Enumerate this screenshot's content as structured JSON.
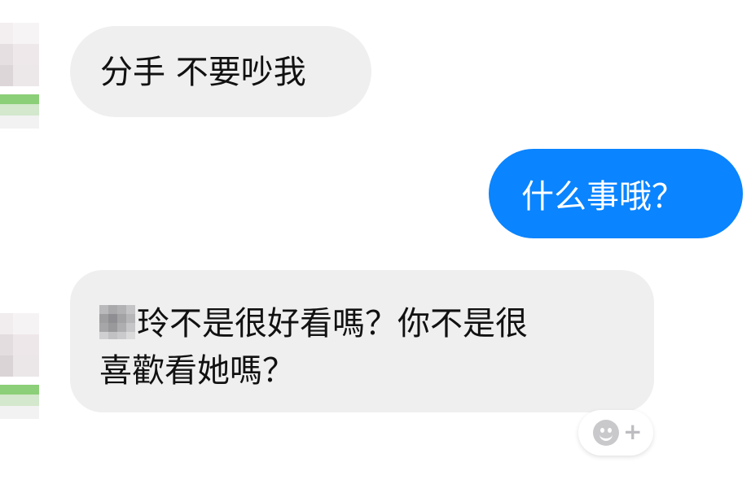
{
  "messages": [
    {
      "direction": "incoming",
      "text": "分手 不要吵我"
    },
    {
      "direction": "outgoing",
      "text": "什么事哦？"
    },
    {
      "direction": "incoming",
      "redacted_prefix": true,
      "line1": "玲不是很好看嗎？你不是很",
      "line2": "喜歡看她嗎？"
    }
  ],
  "reaction_button": {
    "icon": "add-reaction-smiley-icon",
    "plus": "+"
  },
  "colors": {
    "incoming_bubble": "#efeff0",
    "outgoing_bubble": "#0a84ff",
    "incoming_text": "#111111",
    "outgoing_text": "#ffffff"
  }
}
